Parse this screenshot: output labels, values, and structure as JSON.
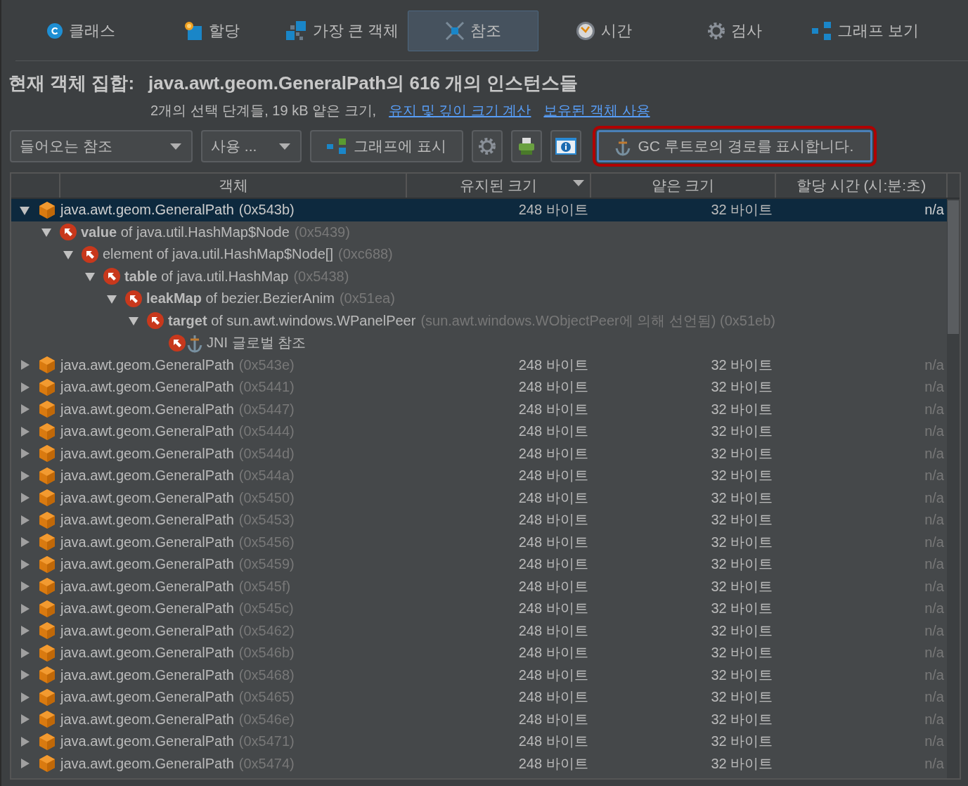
{
  "tabs": [
    {
      "label": "클래스",
      "selected": false
    },
    {
      "label": "할당",
      "selected": false
    },
    {
      "label": "가장 큰 객체",
      "selected": false
    },
    {
      "label": "참조",
      "selected": true
    },
    {
      "label": "시간",
      "selected": false
    },
    {
      "label": "검사",
      "selected": false
    },
    {
      "label": "그래프 보기",
      "selected": false
    }
  ],
  "heading": {
    "label": "현재 객체 집합:",
    "value": "java.awt.geom.GeneralPath의 616 개의 인스턴스들"
  },
  "summary": {
    "text": "2개의 선택 단계들, 19 kB 얕은 크기,",
    "links": [
      "유지 및 깊이 크기 계산",
      "보유된 객체 사용"
    ]
  },
  "toolbar": [
    {
      "kind": "dropdown",
      "label": "들어오는 참조"
    },
    {
      "kind": "dropdown",
      "label": "사용 ..."
    },
    {
      "kind": "button",
      "label": "그래프에 표시",
      "highlighted": false
    },
    {
      "kind": "icon_button"
    },
    {
      "kind": "icon_button"
    },
    {
      "kind": "icon_button"
    },
    {
      "kind": "button",
      "label": "GC 루트로의 경로를 표시합니다.",
      "highlighted": true
    }
  ],
  "table": {
    "columns": [
      {
        "label": "객체",
        "sorted": false
      },
      {
        "label": "유지된 크기",
        "sorted": true
      },
      {
        "label": "얕은 크기",
        "sorted": false
      },
      {
        "label": "할당 시간 (시:분:초)",
        "sorted": false
      }
    ],
    "rows": [
      {
        "kind": "object",
        "label": "java.awt.geom.GeneralPath",
        "address": "(0x543b)",
        "retained": "248 바이트",
        "shallow": "32 바이트",
        "time": "n/a",
        "expanded": true,
        "selected": true,
        "children": [
          {
            "kind": "reference",
            "label": "**value** of java.util.HashMap$Node",
            "address": "(0x5439)",
            "expanded": true,
            "selected": false,
            "children": [
              {
                "kind": "reference",
                "label": "element of java.util.HashMap$Node[]",
                "address": "(0xc688)",
                "expanded": true,
                "selected": false,
                "children": [
                  {
                    "kind": "reference",
                    "label": "**table** of java.util.HashMap",
                    "address": "(0x5438)",
                    "expanded": true,
                    "selected": false,
                    "children": [
                      {
                        "kind": "reference",
                        "label": "**leakMap** of bezier.BezierAnim",
                        "address": "(0x51ea)",
                        "expanded": true,
                        "selected": false,
                        "children": [
                          {
                            "kind": "reference",
                            "label": "**target** of sun.awt.windows.WPanelPeer",
                            "address": "(sun.awt.windows.WObjectPeer에 의해 선언됨) (0x51eb)",
                            "expanded": true,
                            "selected": false,
                            "children": [
                              {
                                "kind": "gc_root",
                                "label": "JNI 글로벌 참조",
                                "selected": false
                              }
                            ]
                          }
                        ]
                      }
                    ]
                  }
                ]
              }
            ]
          }
        ]
      },
      {
        "kind": "object",
        "label": "java.awt.geom.GeneralPath",
        "address": "(0x543e)",
        "retained": "248 바이트",
        "shallow": "32 바이트",
        "time": "n/a",
        "expanded": false,
        "selected": false
      },
      {
        "kind": "object",
        "label": "java.awt.geom.GeneralPath",
        "address": "(0x5441)",
        "retained": "248 바이트",
        "shallow": "32 바이트",
        "time": "n/a",
        "expanded": false,
        "selected": false
      },
      {
        "kind": "object",
        "label": "java.awt.geom.GeneralPath",
        "address": "(0x5447)",
        "retained": "248 바이트",
        "shallow": "32 바이트",
        "time": "n/a",
        "expanded": false,
        "selected": false
      },
      {
        "kind": "object",
        "label": "java.awt.geom.GeneralPath",
        "address": "(0x5444)",
        "retained": "248 바이트",
        "shallow": "32 바이트",
        "time": "n/a",
        "expanded": false,
        "selected": false
      },
      {
        "kind": "object",
        "label": "java.awt.geom.GeneralPath",
        "address": "(0x544d)",
        "retained": "248 바이트",
        "shallow": "32 바이트",
        "time": "n/a",
        "expanded": false,
        "selected": false
      },
      {
        "kind": "object",
        "label": "java.awt.geom.GeneralPath",
        "address": "(0x544a)",
        "retained": "248 바이트",
        "shallow": "32 바이트",
        "time": "n/a",
        "expanded": false,
        "selected": false
      },
      {
        "kind": "object",
        "label": "java.awt.geom.GeneralPath",
        "address": "(0x5450)",
        "retained": "248 바이트",
        "shallow": "32 바이트",
        "time": "n/a",
        "expanded": false,
        "selected": false
      },
      {
        "kind": "object",
        "label": "java.awt.geom.GeneralPath",
        "address": "(0x5453)",
        "retained": "248 바이트",
        "shallow": "32 바이트",
        "time": "n/a",
        "expanded": false,
        "selected": false
      },
      {
        "kind": "object",
        "label": "java.awt.geom.GeneralPath",
        "address": "(0x5456)",
        "retained": "248 바이트",
        "shallow": "32 바이트",
        "time": "n/a",
        "expanded": false,
        "selected": false
      },
      {
        "kind": "object",
        "label": "java.awt.geom.GeneralPath",
        "address": "(0x5459)",
        "retained": "248 바이트",
        "shallow": "32 바이트",
        "time": "n/a",
        "expanded": false,
        "selected": false
      },
      {
        "kind": "object",
        "label": "java.awt.geom.GeneralPath",
        "address": "(0x545f)",
        "retained": "248 바이트",
        "shallow": "32 바이트",
        "time": "n/a",
        "expanded": false,
        "selected": false
      },
      {
        "kind": "object",
        "label": "java.awt.geom.GeneralPath",
        "address": "(0x545c)",
        "retained": "248 바이트",
        "shallow": "32 바이트",
        "time": "n/a",
        "expanded": false,
        "selected": false
      },
      {
        "kind": "object",
        "label": "java.awt.geom.GeneralPath",
        "address": "(0x5462)",
        "retained": "248 바이트",
        "shallow": "32 바이트",
        "time": "n/a",
        "expanded": false,
        "selected": false
      },
      {
        "kind": "object",
        "label": "java.awt.geom.GeneralPath",
        "address": "(0x546b)",
        "retained": "248 바이트",
        "shallow": "32 바이트",
        "time": "n/a",
        "expanded": false,
        "selected": false
      },
      {
        "kind": "object",
        "label": "java.awt.geom.GeneralPath",
        "address": "(0x5468)",
        "retained": "248 바이트",
        "shallow": "32 바이트",
        "time": "n/a",
        "expanded": false,
        "selected": false
      },
      {
        "kind": "object",
        "label": "java.awt.geom.GeneralPath",
        "address": "(0x5465)",
        "retained": "248 바이트",
        "shallow": "32 바이트",
        "time": "n/a",
        "expanded": false,
        "selected": false
      },
      {
        "kind": "object",
        "label": "java.awt.geom.GeneralPath",
        "address": "(0x546e)",
        "retained": "248 바이트",
        "shallow": "32 바이트",
        "time": "n/a",
        "expanded": false,
        "selected": false
      },
      {
        "kind": "object",
        "label": "java.awt.geom.GeneralPath",
        "address": "(0x5471)",
        "retained": "248 바이트",
        "shallow": "32 바이트",
        "time": "n/a",
        "expanded": false,
        "selected": false
      },
      {
        "kind": "object",
        "label": "java.awt.geom.GeneralPath",
        "address": "(0x5474)",
        "retained": "248 바이트",
        "shallow": "32 바이트",
        "time": "n/a",
        "expanded": false,
        "selected": false
      }
    ]
  }
}
